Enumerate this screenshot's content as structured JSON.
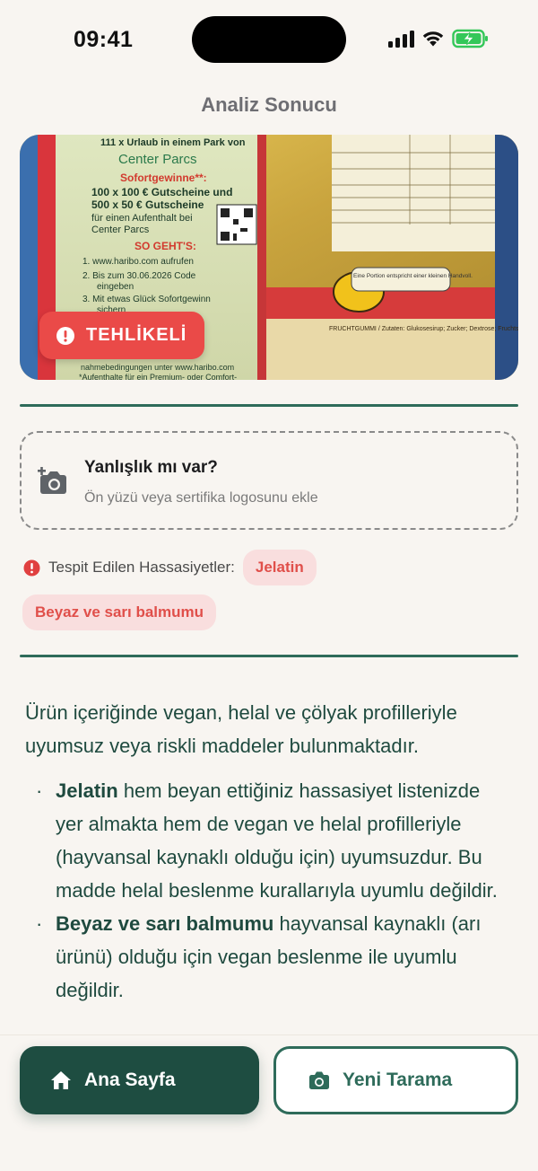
{
  "status_bar": {
    "time": "09:41"
  },
  "header": {
    "title": "Analiz Sonucu"
  },
  "hero": {
    "badge_label": "TEHLİKELİ",
    "package_text": {
      "line1": "111 x Urlaub in einem Park von",
      "brand": "Center Parcs",
      "line2": "Sofortgewinne**:",
      "line3": "100 x 100 € Gutscheine und",
      "line4": "500 x 50 € Gutscheine",
      "line5": "für einen Aufenthalt bei",
      "line6": "Center Parcs",
      "line7": "SO GEHT'S:",
      "step1": "1. www.haribo.com aufrufen",
      "step2": "2. Bis zum 30.06.2026 Code",
      "step2b": "eingeben",
      "step3": "3. Mit etwas Glück Sofortgewinn",
      "step3b": "sichern",
      "footer1": "nahmebedingungen unter www.haribo.com",
      "footer2": "*Aufenthalte für ein Premium- oder Comfort-",
      "portion": "Eine Portion entspricht einer kleinen Handvoll.",
      "ingredients": "FRUCHTGUMMI / Zutaten: Glukosesirup; Zucker; Dextrose; Fruchtsaft aus Fruchtsaftkonzentrat: Apfel, Himbeere, Erdbeere, Zitrone, Ananas; Säuerungsmittel: Citronensäure; Sonnenblumen; Pflanzenkonzentrate: Saflor, Spirulina, Apfel, Holunderbeere, Johannisbeere, Kiwi, Zitrone, Aronia, Mango, Traube, Passionsfrucht; Holunderbeerextrakt; Überzugsmittel: Bienenwachs weiß und gelb"
    }
  },
  "upload": {
    "title": "Yanlışlık mı var?",
    "subtitle": "Ön yüzü veya sertifika logosunu ekle"
  },
  "sensitivities": {
    "label": "Tespit Edilen Hassasiyetler:",
    "items": [
      "Jelatin",
      "Beyaz ve sarı balmumu"
    ]
  },
  "analysis": {
    "summary": "Ürün içeriğinde vegan, helal ve çölyak profilleriyle uyumsuz veya riskli maddeler bulunmaktadır.",
    "bullets": [
      {
        "bold": "Jelatin",
        "text": " hem beyan ettiğiniz hassasiyet listenizde yer almakta hem de vegan ve helal profilleriyle (hayvansal kaynaklı olduğu için) uyumsuzdur. Bu madde helal beslenme kurallarıyla uyumlu değildir."
      },
      {
        "bold": "Beyaz ve sarı balmumu",
        "text": " hayvansal kaynaklı (arı ürünü) olduğu için vegan beslenme ile uyumlu değildir."
      }
    ]
  },
  "bottom_nav": {
    "home_label": "Ana Sayfa",
    "scan_label": "Yeni Tarama"
  },
  "colors": {
    "background": "#f8f5f1",
    "primary": "#1e4d41",
    "accent": "#2e6b5a",
    "danger": "#ea4a48",
    "chip_bg": "#f9dede",
    "chip_text": "#e04f4a"
  },
  "icons": {
    "signal": "cellular-signal-icon",
    "wifi": "wifi-icon",
    "battery": "battery-charging-icon",
    "badge": "alert-circle-icon",
    "upload": "add-photo-camera-icon",
    "sensitivity": "alert-circle-icon",
    "home": "home-icon",
    "scan": "camera-icon"
  }
}
